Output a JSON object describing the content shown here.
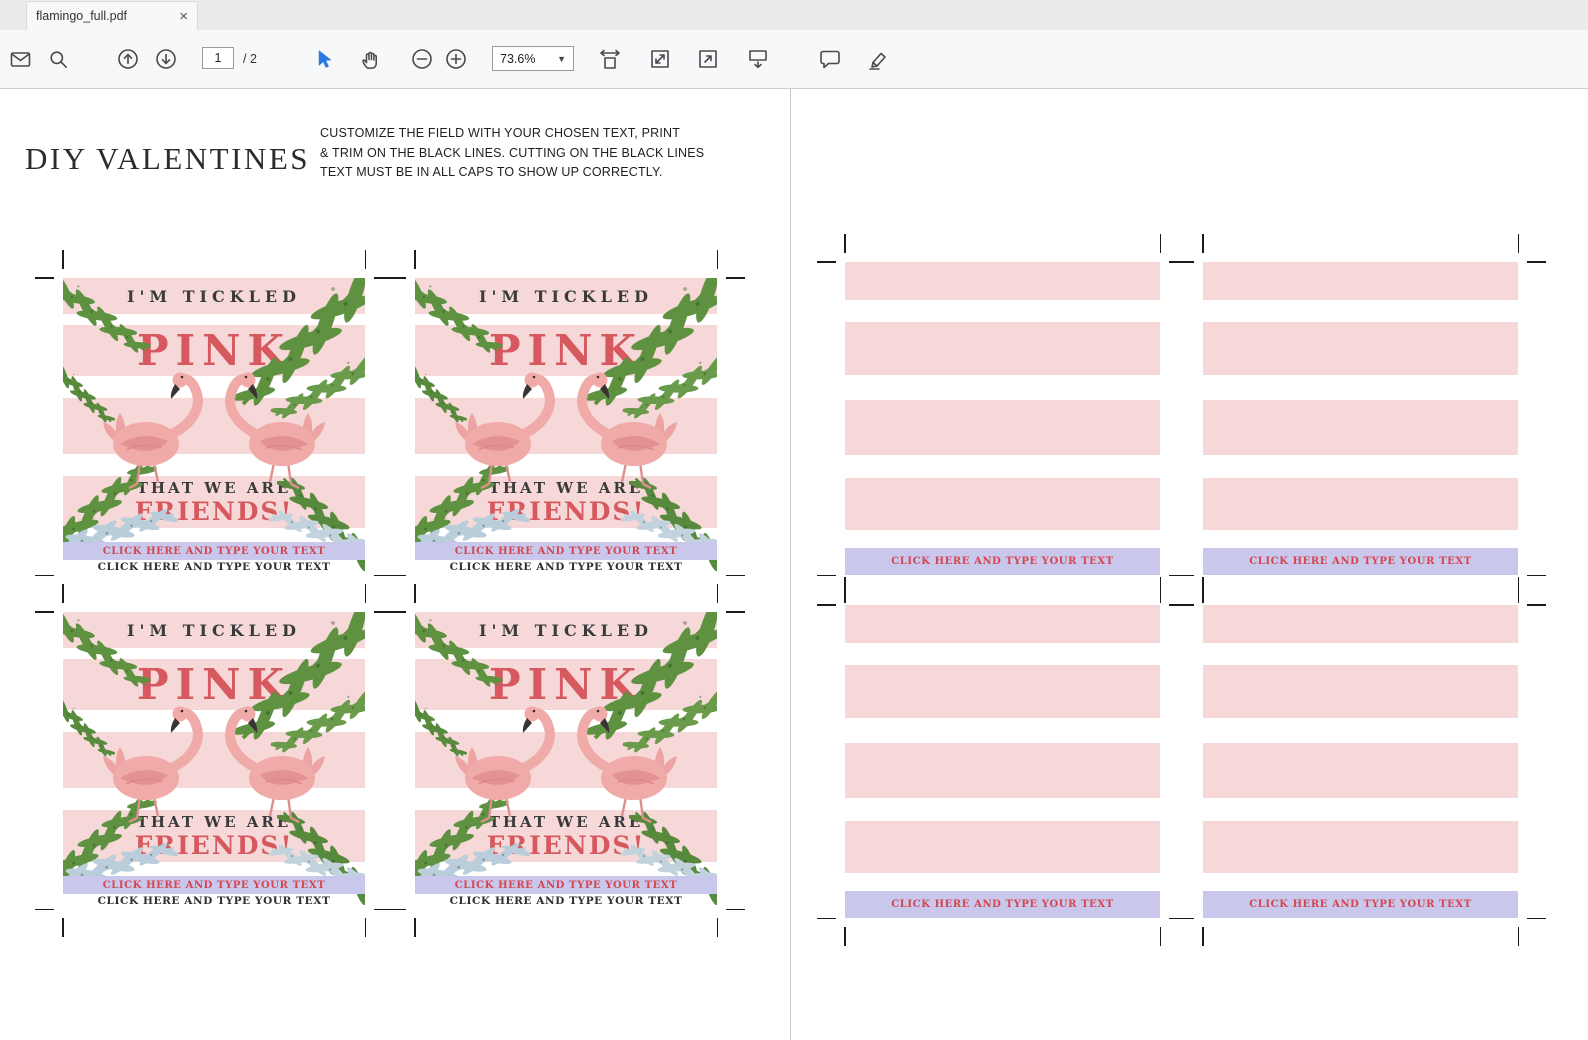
{
  "tab": {
    "title": "flamingo_full.pdf",
    "close_glyph": "×"
  },
  "toolbar": {
    "page_current": "1",
    "page_total": "/ 2",
    "zoom": "73.6%",
    "icons": [
      "email-icon",
      "search-icon",
      "previous-page-icon",
      "next-page-icon",
      "select-tool-icon",
      "hand-tool-icon",
      "zoom-out-icon",
      "zoom-in-icon",
      "zoom-dropdown",
      "fit-width-icon",
      "fit-page-icon",
      "fullscreen-icon",
      "scroll-mode-icon",
      "comment-icon",
      "highlight-icon"
    ]
  },
  "page": {
    "heading": "DIY VALENTINES",
    "instructions_line1": "CUSTOMIZE THE FIELD WITH YOUR CHOSEN TEXT, PRINT",
    "instructions_line2": "& TRIM ON THE BLACK LINES. CUTTING ON THE BLACK LINES",
    "instructions_line3": "TEXT MUST BE IN ALL CAPS TO SHOW UP CORRECTLY."
  },
  "card": {
    "top_line": "I'M TICKLED",
    "big_word": "PINK",
    "sub_line": "THAT WE ARE",
    "friends_line": "FRIENDS!",
    "click_field_red": "CLICK HERE AND TYPE YOUR TEXT",
    "click_field_dark": "CLICK HERE AND TYPE YOUR TEXT"
  },
  "blank": {
    "click_field_red": "CLICK HERE AND TYPE YOUR TEXT"
  },
  "colors": {
    "stripe_pink": "#f6d8d8",
    "lavender": "#c9c7ec",
    "accent_red": "#d5595e",
    "leaf_green": "#5e9140",
    "leaf_blue": "#b9cdda"
  }
}
